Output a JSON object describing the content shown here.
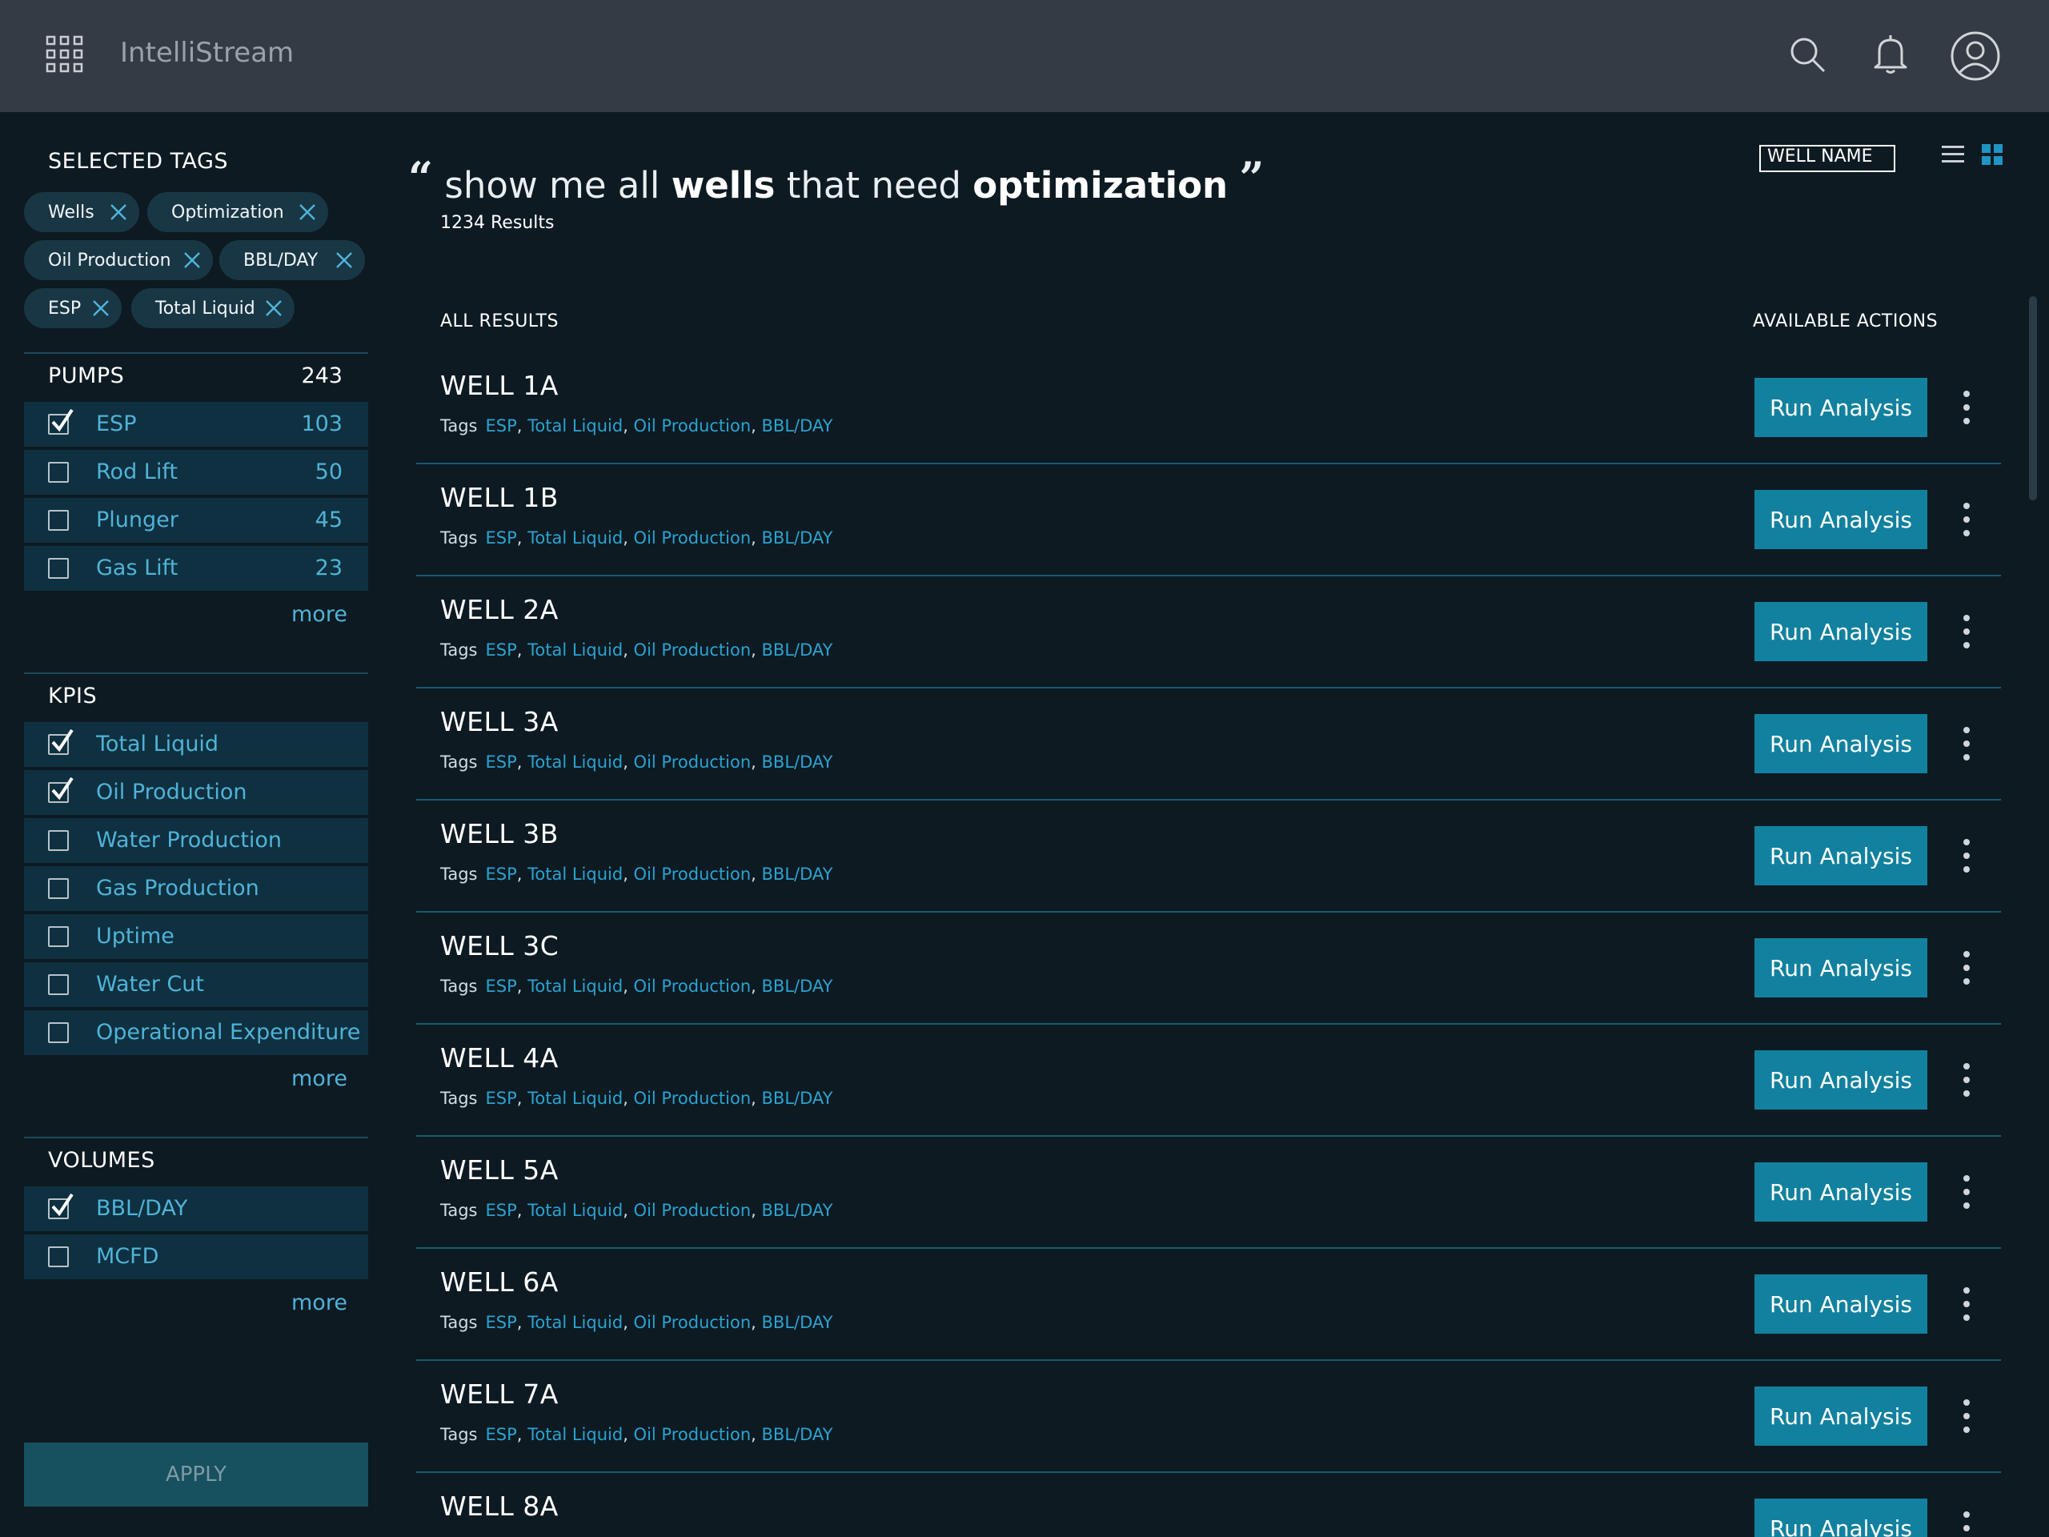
{
  "app": {
    "title": "IntelliStream"
  },
  "sidebar": {
    "selected_tags_title": "SELECTED TAGS",
    "tags": [
      "Wells",
      "Optimization",
      "Oil Production",
      "BBL/DAY",
      "ESP",
      "Total Liquid"
    ],
    "pumps": {
      "title": "PUMPS",
      "count": "243",
      "more": "more",
      "items": [
        {
          "label": "ESP",
          "count": "103",
          "checked": true
        },
        {
          "label": "Rod Lift",
          "count": "50",
          "checked": false
        },
        {
          "label": "Plunger",
          "count": "45",
          "checked": false
        },
        {
          "label": "Gas Lift",
          "count": "23",
          "checked": false
        }
      ]
    },
    "kpis": {
      "title": "KPIS",
      "more": "more",
      "items": [
        {
          "label": "Total Liquid",
          "checked": true
        },
        {
          "label": "Oil Production",
          "checked": true
        },
        {
          "label": "Water Production",
          "checked": false
        },
        {
          "label": "Gas Production",
          "checked": false
        },
        {
          "label": "Uptime",
          "checked": false
        },
        {
          "label": "Water Cut",
          "checked": false
        },
        {
          "label": "Operational Expenditure",
          "checked": false
        }
      ]
    },
    "volumes": {
      "title": "VOLUMES",
      "more": "more",
      "items": [
        {
          "label": "BBL/DAY",
          "checked": true
        },
        {
          "label": "MCFD",
          "checked": false
        }
      ]
    },
    "apply_label": "APPLY"
  },
  "query": {
    "open_quote": "“",
    "part1": "show me all",
    "term1": "wells",
    "part2": "that need",
    "term2": "optimization",
    "close_quote": "”",
    "results": "1234 Results"
  },
  "controls": {
    "sort_value": "WELL NAME"
  },
  "list": {
    "header_left": "ALL RESULTS",
    "header_right": "AVAILABLE ACTIONS",
    "tags_label": "Tags",
    "action_label": "Run Analysis",
    "row_tags": [
      "ESP",
      "Total Liquid",
      "Oil Production",
      "BBL/DAY"
    ],
    "wells": [
      "WELL 1A",
      "WELL 1B",
      "WELL 2A",
      "WELL 3A",
      "WELL 3B",
      "WELL 3C",
      "WELL 4A",
      "WELL 5A",
      "WELL 6A",
      "WELL 7A",
      "WELL 8A"
    ]
  },
  "colors": {
    "accent": "#12819f",
    "link": "#4fb3d7",
    "background": "#0d1a22",
    "topbar": "#353b44"
  }
}
